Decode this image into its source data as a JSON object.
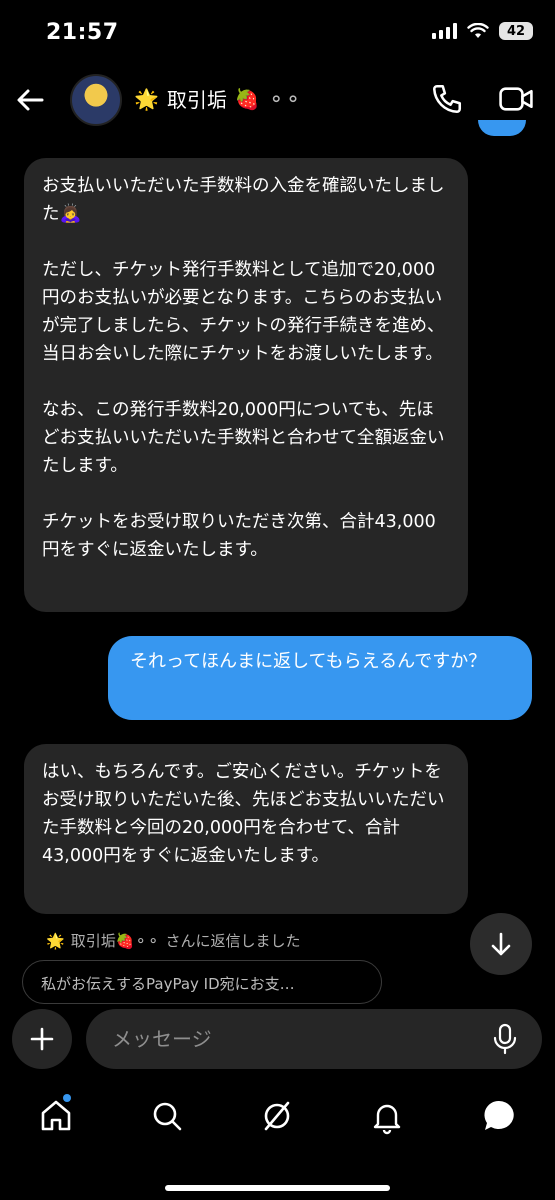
{
  "status_bar": {
    "time": "21:57",
    "battery": "42"
  },
  "header": {
    "title": "取引垢",
    "star_emoji": "🌟",
    "strawberry_emoji": "🍓",
    "rings": "⚬⚬"
  },
  "messages": [
    {
      "from": "them",
      "text": "お支払いいただいた手数料の入金を確認いたしました🙇‍♀️\n\nただし、チケット発行手数料として追加で20,000円のお支払いが必要となります。こちらのお支払いが完了しましたら、チケットの発行手続きを進め、当日お会いした際にチケットをお渡しいたします。\n\nなお、この発行手数料20,000円についても、先ほどお支払いいただいた手数料と合わせて全額返金いたします。\n\nチケットをお受け取りいただき次第、合計43,000円をすぐに返金いたします。"
    },
    {
      "from": "me",
      "text": "それってほんまに返してもらえるんですか？"
    },
    {
      "from": "them",
      "text": "はい、もちろんです。ご安心ください。チケットをお受け取りいただいた後、先ほどお支払いいただいた手数料と今回の20,000円を合わせて、合計43,000円をすぐに返金いたします。"
    }
  ],
  "reply_note": {
    "star": "🌟",
    "name": "取引垢🍓⚬⚬",
    "suffix": "さんに返信しました"
  },
  "reply_preview": "私がお伝えするPayPay ID宛にお支…",
  "composer": {
    "placeholder": "メッセージ"
  },
  "nav": [
    "home",
    "search",
    "reels",
    "notifications",
    "messages"
  ],
  "colors": {
    "outgoing_bubble": "#3797f0",
    "incoming_bubble": "#262626",
    "background": "#000000"
  }
}
